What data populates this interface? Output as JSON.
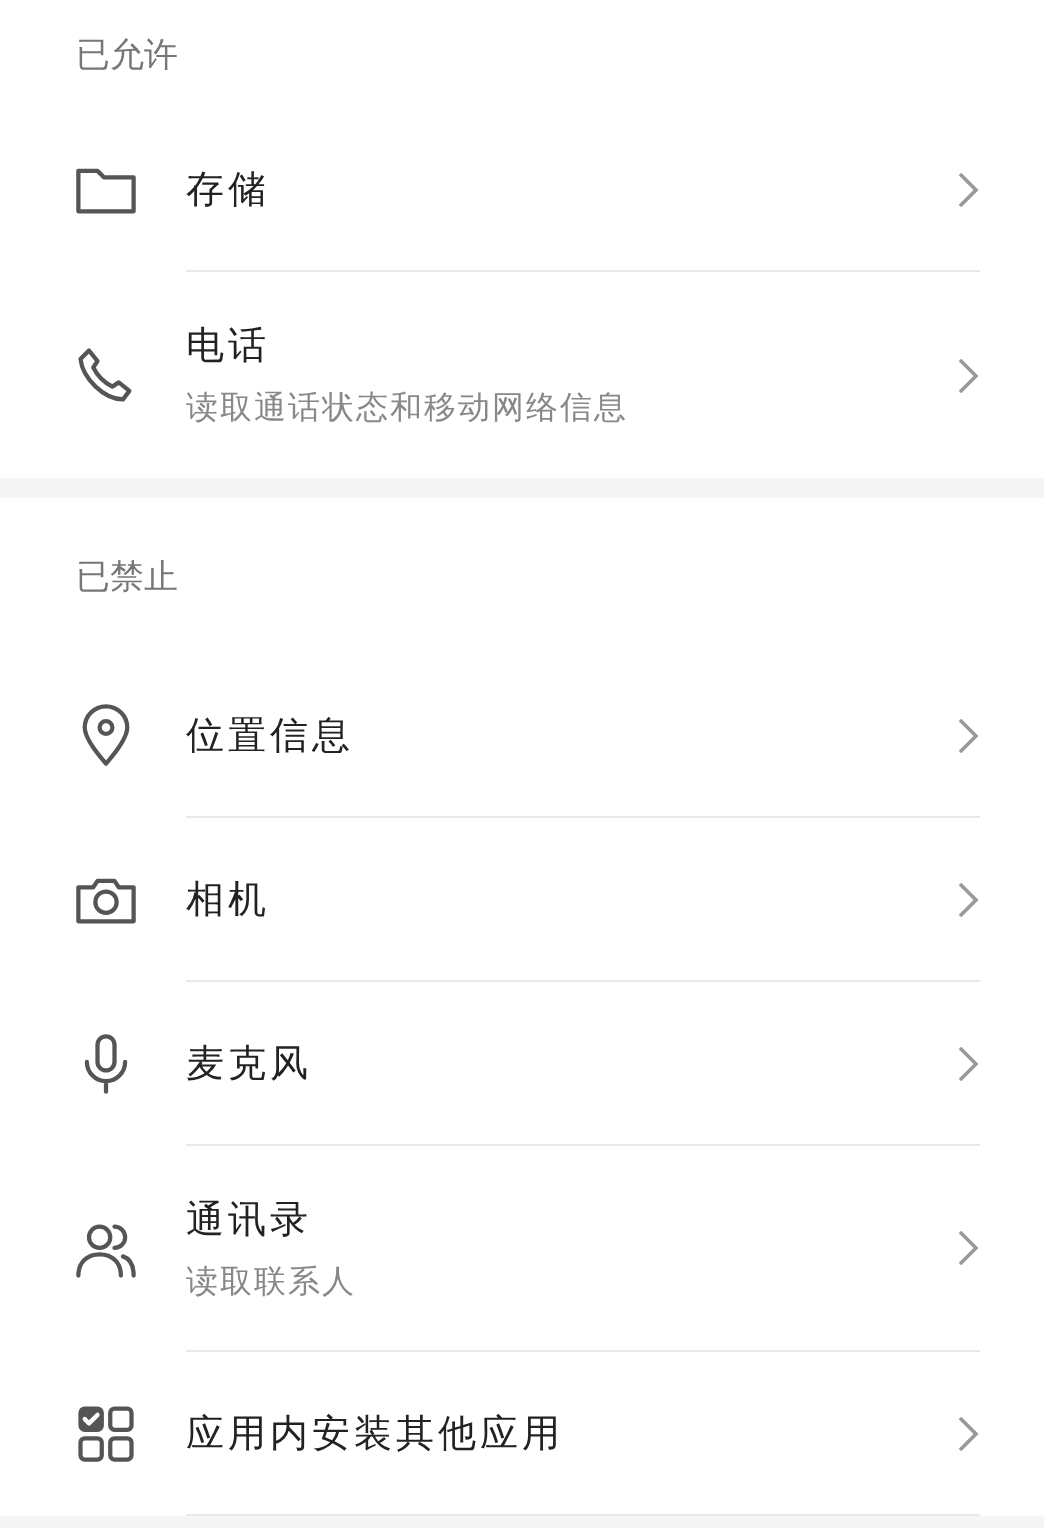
{
  "sections": [
    {
      "title": "已允许",
      "items": [
        {
          "kind": "folder",
          "label": "存储"
        },
        {
          "kind": "phone",
          "label": "电话",
          "description": "读取通话状态和移动网络信息"
        }
      ]
    },
    {
      "title": "已禁止",
      "items": [
        {
          "kind": "location",
          "label": "位置信息"
        },
        {
          "kind": "camera",
          "label": "相机"
        },
        {
          "kind": "mic",
          "label": "麦克风"
        },
        {
          "kind": "contacts",
          "label": "通讯录",
          "description": "读取联系人"
        },
        {
          "kind": "apps",
          "label": "应用内安装其他应用"
        }
      ]
    }
  ]
}
